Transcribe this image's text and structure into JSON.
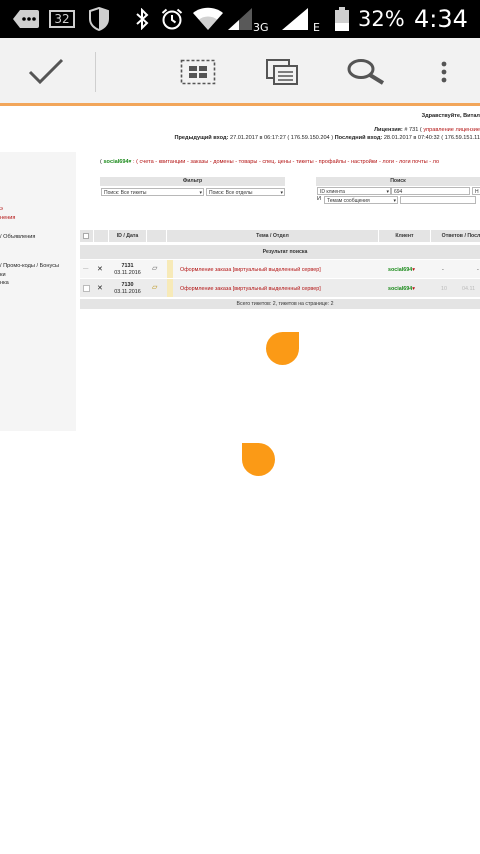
{
  "status_bar": {
    "notif_count": "32",
    "network_3g": "3G",
    "network_e": "E",
    "battery_pct": "32%",
    "time": "4:34"
  },
  "toolbar": {
    "icons": [
      "check-icon",
      "select-all-icon",
      "copy-icon",
      "search-icon",
      "more-icon"
    ]
  },
  "page": {
    "greeting": "Здравствуйте, Витал",
    "license_label": "Лицензия:",
    "license_value": "# 731 (",
    "license_link": "управление лицензие",
    "prev_login_label": "Предыдущий вход:",
    "prev_login_value": "27.01.2017 в 06:17:27 ( 176.59.150.204 )",
    "last_login_label": "Последний вход:",
    "last_login_value": "28.01.2017 в 07:40:32 ( 176.59.151.11",
    "nav_user": "social694",
    "nav_links": ": ( счета - квитанции - заказы - домены - товары - спец. цены - тикеты - профайлы - настройки - логи - логи почты - ло",
    "sidebar_items": [
      {
        "label": "э",
        "color": "#b31212"
      },
      {
        "label": "нения",
        "color": "#b31212"
      },
      {
        "label": "/ Объявления",
        "color": "#222222"
      },
      {
        "label": "/ Промо-коды / Бонусы",
        "color": "#222222"
      },
      {
        "label": "ки",
        "color": "#222222"
      },
      {
        "label": "нка",
        "color": "#222222"
      }
    ],
    "filter": {
      "title": "Фильтр",
      "select1": "Поиск: Все тикеты",
      "select2": "Поиск: Все отделы"
    },
    "search": {
      "title": "Поиск",
      "row1_select": "ID клиента",
      "row1_input": "694",
      "row1_tail": "Н",
      "row2_prefix": "И",
      "row2_select": "Темам сообщения"
    },
    "table": {
      "headers": [
        "ID / Дата",
        "Тема / Отдел",
        "Клиент",
        "Ответов / Посл"
      ],
      "result_title": "Результат поиска",
      "rows": [
        {
          "id": "7131",
          "date": "03.11.2016",
          "subject": "Оформление заказа [виртуальный выделенный сервер]",
          "client": "social694",
          "answers": "-",
          "last": "-"
        },
        {
          "id": "7130",
          "date": "03.11.2016",
          "subject": "Оформление заказа [виртуальный выделенный сервер]",
          "client": "social694",
          "answers": "10",
          "last": "04.11"
        }
      ],
      "row1_mark": "—",
      "footer": "Всего тикетов: 2, тикетов на странице: 2"
    }
  },
  "colors": {
    "accent": "#f2a65a",
    "loader": "#fb9a16",
    "link_red": "#b31212",
    "user_green": "#1a8a1a"
  }
}
